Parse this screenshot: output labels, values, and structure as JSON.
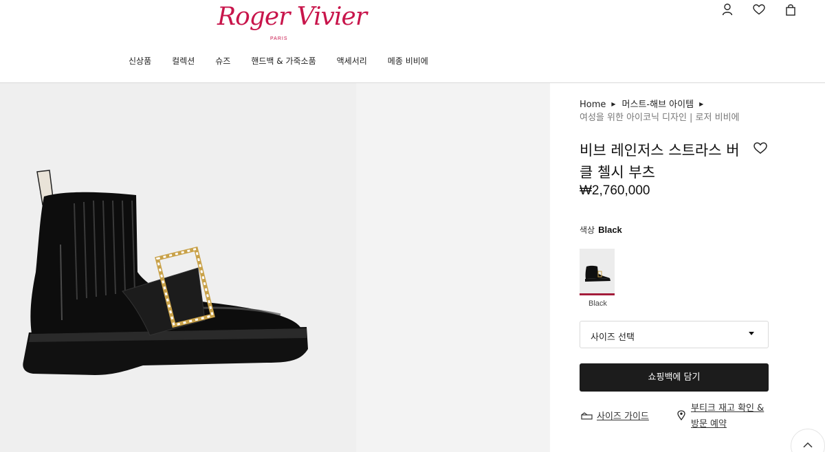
{
  "brand": {
    "logo_text": "Roger Vivier",
    "logo_sub": "PARIS",
    "color": "#c8154b"
  },
  "nav": [
    {
      "label": "신상품"
    },
    {
      "label": "컬렉션"
    },
    {
      "label": "슈즈"
    },
    {
      "label": "핸드백 & 가죽소품"
    },
    {
      "label": "액세서리"
    },
    {
      "label": "메종 비비에"
    }
  ],
  "header_icons": [
    "account-icon",
    "wishlist-icon",
    "shopping-bag-icon"
  ],
  "breadcrumb": {
    "items": [
      "Home",
      "머스트-해브 아이템"
    ],
    "subtitle": "여성을 위한 아이코닉 디자인 | 로저 비비에"
  },
  "product": {
    "title": "비브 레인저스 스트라스 버클 첼시 부츠",
    "price": "₩2,760,000",
    "color_label": "색상",
    "color_value": "Black",
    "swatch_label": "Black",
    "size_placeholder": "사이즈 선택",
    "add_to_bag": "쇼핑백에 담기",
    "size_guide": "사이즈 가이드",
    "boutique": "부티크 재고 확인 & 방문 예약",
    "accent_color": "#a31c3a"
  }
}
